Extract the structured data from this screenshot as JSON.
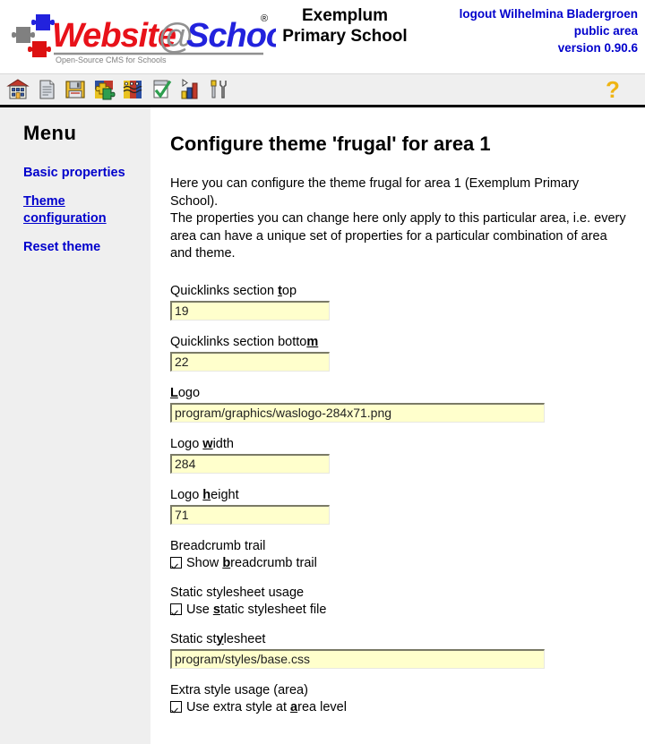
{
  "header": {
    "logo_alt": "Website@School",
    "logo_text_web": "Website",
    "logo_text_at": "@",
    "logo_text_school": "School",
    "logo_registered": "®",
    "logo_tagline": "Open-Source CMS for Schools",
    "school_name_line1": "Exemplum",
    "school_name_line2": "Primary School",
    "logout_text": "logout Wilhelmina Bladergroen",
    "area_text": "public area",
    "version_text": "version 0.90.6",
    "link_color": "#0000CC"
  },
  "toolbar": {
    "icons": [
      {
        "name": "home-icon",
        "title": "Home"
      },
      {
        "name": "pages-icon",
        "title": "Pages"
      },
      {
        "name": "file-manager-icon",
        "title": "File manager"
      },
      {
        "name": "modules-icon",
        "title": "Modules"
      },
      {
        "name": "areas-icon",
        "title": "Areas"
      },
      {
        "name": "account-icon",
        "title": "Account"
      },
      {
        "name": "statistics-icon",
        "title": "Statistics"
      },
      {
        "name": "tools-icon",
        "title": "Tools"
      }
    ],
    "help_icon": {
      "name": "help-icon",
      "glyph": "?",
      "title": "Help"
    }
  },
  "sidebar": {
    "title": "Menu",
    "items": [
      {
        "label": "Basic properties",
        "active": false
      },
      {
        "label": "Theme configuration",
        "active": true
      },
      {
        "label": "Reset theme",
        "active": false
      }
    ]
  },
  "main": {
    "page_title": "Configure theme 'frugal' for area 1",
    "intro_line1": "Here you can configure the theme frugal for area 1 (Exemplum Primary School).",
    "intro_line2": "The properties you can change here only apply to this particular area, i.e. every area can have a unique set of properties for a particular combination of area and theme.",
    "fields": [
      {
        "type": "text",
        "name": "quicklinks-section-top",
        "label_pre": "Quicklinks section ",
        "label_key": "t",
        "label_post": "op",
        "value": "19",
        "width": "small"
      },
      {
        "type": "text",
        "name": "quicklinks-section-bottom",
        "label_pre": "Quicklinks section botto",
        "label_key": "m",
        "label_post": "",
        "value": "22",
        "width": "small"
      },
      {
        "type": "text",
        "name": "logo",
        "label_pre": "",
        "label_key": "L",
        "label_post": "ogo",
        "value": "program/graphics/waslogo-284x71.png",
        "width": "wide"
      },
      {
        "type": "text",
        "name": "logo-width",
        "label_pre": "Logo ",
        "label_key": "w",
        "label_post": "idth",
        "value": "284",
        "width": "small"
      },
      {
        "type": "text",
        "name": "logo-height",
        "label_pre": "Logo ",
        "label_key": "h",
        "label_post": "eight",
        "value": "71",
        "width": "small"
      },
      {
        "type": "checkbox",
        "name": "breadcrumb-trail",
        "group_label": "Breadcrumb trail",
        "label_pre": "Show ",
        "label_key": "b",
        "label_post": "readcrumb trail",
        "checked": true
      },
      {
        "type": "checkbox",
        "name": "static-stylesheet-usage",
        "group_label": "Static stylesheet usage",
        "label_pre": "Use ",
        "label_key": "s",
        "label_post": "tatic stylesheet file",
        "checked": true
      },
      {
        "type": "text",
        "name": "static-stylesheet",
        "label_pre": "Static st",
        "label_key": "y",
        "label_post": "lesheet",
        "value": "program/styles/base.css",
        "width": "wide"
      },
      {
        "type": "checkbox",
        "name": "extra-style-usage-area",
        "group_label": "Extra style usage (area)",
        "label_pre": "Use extra style at ",
        "label_key": "a",
        "label_post": "rea level",
        "checked": true
      }
    ]
  },
  "colors": {
    "sidebar_bg": "#EFEFEF",
    "toolbar_bg": "#EFEFEF",
    "input_bg": "#FFFFCC",
    "link": "#0000CC",
    "help_yellow": "#EFB413"
  }
}
